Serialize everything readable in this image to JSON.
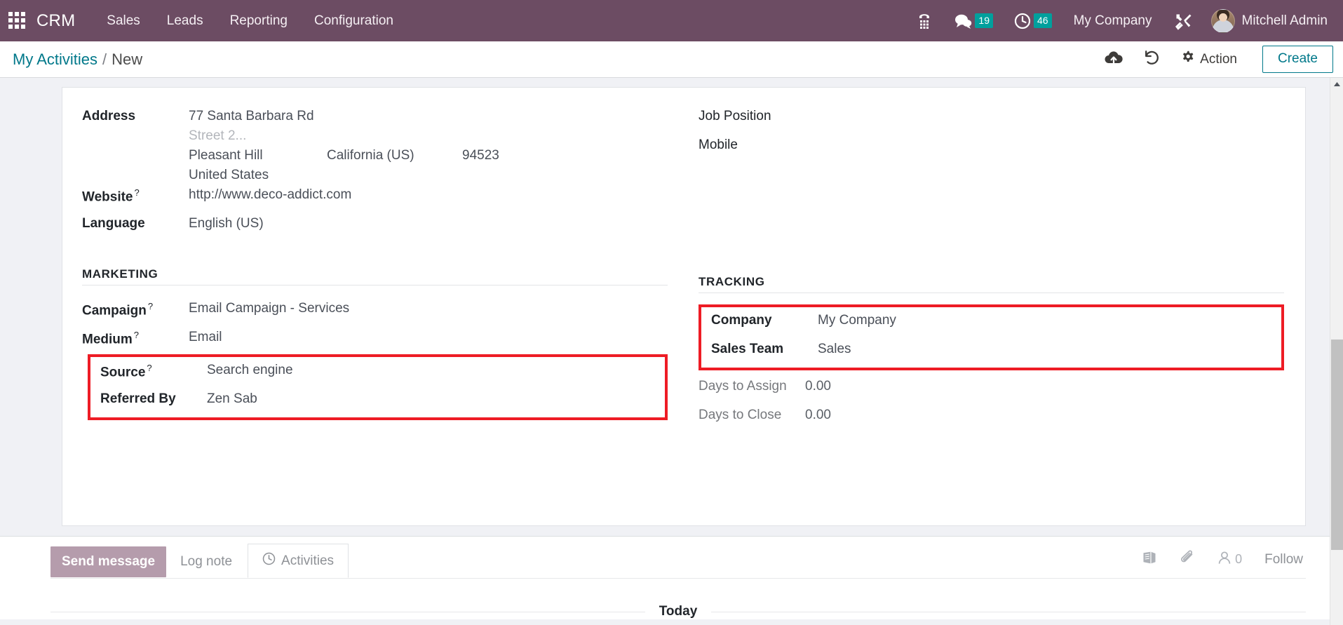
{
  "navbar": {
    "apps_icon": "apps-grid-icon",
    "brand": "CRM",
    "menu": [
      {
        "label": "Sales"
      },
      {
        "label": "Leads"
      },
      {
        "label": "Reporting"
      },
      {
        "label": "Configuration"
      }
    ],
    "voip_icon": "phone-dialpad-icon",
    "messages_icon": "chat-bubble-icon",
    "messages_count": "19",
    "activities_icon": "clock-icon",
    "activities_count": "46",
    "company": "My Company",
    "tools_icon": "wrench-screwdriver-icon",
    "user_name": "Mitchell Admin",
    "accent": "#6c4c63",
    "badge_color": "#00a09d"
  },
  "control_panel": {
    "breadcrumb_root": "My Activities",
    "breadcrumb_sep": "/",
    "breadcrumb_current": "New",
    "save_icon": "cloud-upload-icon",
    "discard_icon": "undo-icon",
    "action_icon": "gear-icon",
    "action_label": "Action",
    "create_label": "Create",
    "accent": "#00788a"
  },
  "form": {
    "left": {
      "address": {
        "label": "Address",
        "street": "77 Santa Barbara Rd",
        "street2_placeholder": "Street 2...",
        "city": "Pleasant Hill",
        "state": "California (US)",
        "zip": "94523",
        "country": "United States"
      },
      "website": {
        "label": "Website",
        "help": "?",
        "value": "http://www.deco-addict.com"
      },
      "language": {
        "label": "Language",
        "value": "English (US)"
      },
      "marketing_section": "MARKETING",
      "campaign": {
        "label": "Campaign",
        "help": "?",
        "value": "Email Campaign - Services"
      },
      "medium": {
        "label": "Medium",
        "help": "?",
        "value": "Email"
      },
      "source": {
        "label": "Source",
        "help": "?",
        "value": "Search engine"
      },
      "referred_by": {
        "label": "Referred By",
        "value": "Zen Sab"
      }
    },
    "right": {
      "job_position": {
        "label": "Job Position",
        "value": ""
      },
      "mobile": {
        "label": "Mobile",
        "value": ""
      },
      "tracking_section": "TRACKING",
      "company": {
        "label": "Company",
        "value": "My Company"
      },
      "sales_team": {
        "label": "Sales Team",
        "value": "Sales"
      },
      "days_to_assign": {
        "label": "Days to Assign",
        "value": "0.00"
      },
      "days_to_close": {
        "label": "Days to Close",
        "value": "0.00"
      }
    },
    "highlight_color": "#ee1c25"
  },
  "chatter": {
    "send_message": "Send message",
    "log_note": "Log note",
    "activities": "Activities",
    "activities_icon": "clock-icon",
    "log_icon": "book-icon",
    "attachment_icon": "paperclip-icon",
    "followers_icon": "user-icon",
    "followers_count": "0",
    "follow_label": "Follow",
    "today_label": "Today"
  }
}
